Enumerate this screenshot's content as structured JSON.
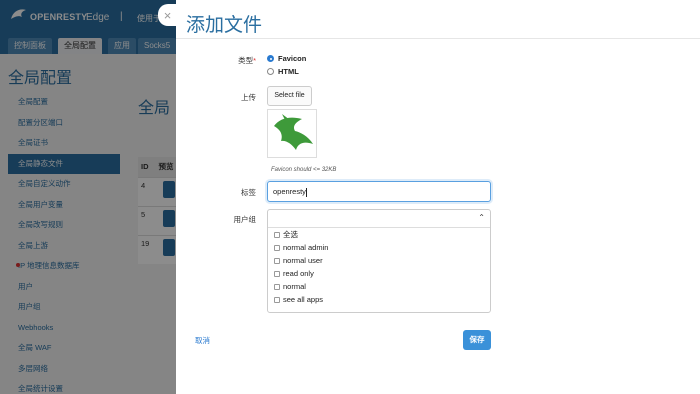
{
  "background": {
    "app_name": "OPENRESTY",
    "app_suffix": "Edge",
    "separator": "|",
    "user_text": "使用于",
    "tabs": [
      {
        "label": "控制面板",
        "active": false
      },
      {
        "label": "全局配置",
        "active": true
      },
      {
        "label": "应用",
        "active": false
      },
      {
        "label": "Socks5",
        "active": false
      }
    ],
    "page_title": "全局配置",
    "main_title": "全局",
    "sidebar": [
      {
        "label": "全局配置",
        "active": false
      },
      {
        "label": "配置分区端口",
        "active": false
      },
      {
        "label": "全局证书",
        "active": false
      },
      {
        "label": "全局静态文件",
        "active": true
      },
      {
        "label": "全局自定义动作",
        "active": false
      },
      {
        "label": "全局用户变量",
        "active": false
      },
      {
        "label": "全局改写规则",
        "active": false
      },
      {
        "label": "全局上游",
        "active": false
      },
      {
        "label": "IP 地理信息数据库",
        "active": false
      },
      {
        "label": "用户",
        "active": false
      },
      {
        "label": "用户组",
        "active": false
      },
      {
        "label": "Webhooks",
        "active": false
      },
      {
        "label": "全局 WAF",
        "active": false
      },
      {
        "label": "多层网络",
        "active": false
      },
      {
        "label": "全局统计设置",
        "active": false
      }
    ],
    "table": {
      "headers": [
        "ID",
        "预览"
      ],
      "rows": [
        {
          "id": "4"
        },
        {
          "id": "5"
        },
        {
          "id": "19"
        }
      ]
    }
  },
  "dialog": {
    "title": "添加文件",
    "close_symbol": "×",
    "type_label": "类型",
    "required_mark": "*",
    "type_options": [
      {
        "label": "Favicon",
        "checked": true
      },
      {
        "label": "HTML",
        "checked": false
      }
    ],
    "upload_label": "上传",
    "select_file_label": "Select file",
    "favicon_hint": "Favicon should <= 32KB",
    "tag_label": "标签",
    "tag_value": "openresty",
    "usergroup_label": "用户组",
    "usergroup_chevron": "⌃",
    "usergroup_options": [
      "全选",
      "normal admin",
      "normal user",
      "read only",
      "normal",
      "see all apps"
    ],
    "cancel_label": "取消",
    "save_label": "保存"
  },
  "colors": {
    "brand": "#2a6ea0",
    "link": "#2a7ad0",
    "primary_button": "#3a91d9"
  }
}
